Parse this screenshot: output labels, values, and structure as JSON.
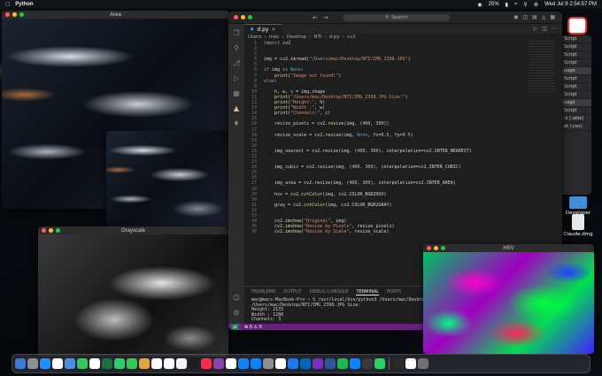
{
  "menubar": {
    "app_name": "Python",
    "clock": "Wed Jul 9  2:54:57 PM",
    "battery": "25%"
  },
  "windows": {
    "area": {
      "title": "Area"
    },
    "grayscale": {
      "title": "Grayscale"
    },
    "hsv": {
      "title": "HSV"
    }
  },
  "vscode": {
    "search_placeholder": "Search",
    "tab_label": "d.py",
    "breadcrumb": [
      "Users",
      "mac",
      "Desktop",
      "NTI",
      "d.py",
      "cv2"
    ],
    "code_lines": [
      [
        "1",
        "import cv2"
      ],
      [
        "2",
        ""
      ],
      [
        "3",
        ""
      ],
      [
        "4",
        "img = cv2.imread(\"/Users/mac/Desktop/NTI/IMG_2398.JPG\")"
      ],
      [
        "5",
        ""
      ],
      [
        "6",
        "if img is None:"
      ],
      [
        "7",
        "    print(\"Image not found!\")"
      ],
      [
        "8",
        "else:"
      ],
      [
        "9",
        ""
      ],
      [
        "10",
        "    h, w, c = img.shape"
      ],
      [
        "11",
        "    print(\"/Users/mac/Desktop/NTI/IMG_2398.JPG Size:\")"
      ],
      [
        "12",
        "    print(\"Height:\", h)"
      ],
      [
        "13",
        "    print(\"Width :\", w)"
      ],
      [
        "14",
        "    print(\"Channels:\", c)"
      ],
      [
        "15",
        ""
      ],
      [
        "16",
        "    resize_pixels = cv2.resize(img, (400, 300))"
      ],
      [
        "17",
        ""
      ],
      [
        "18",
        "    resize_scale = cv2.resize(img, None, fx=0.5, fy=0.5)"
      ],
      [
        "19",
        ""
      ],
      [
        "20",
        ""
      ],
      [
        "21",
        "    img_nearest = cv2.resize(img, (400, 300), interpolation=cv2.INTER_NEAREST)"
      ],
      [
        "22",
        ""
      ],
      [
        "23",
        ""
      ],
      [
        "24",
        "    img_cubic = cv2.resize(img, (400, 300), interpolation=cv2.INTER_CUBIC)"
      ],
      [
        "25",
        ""
      ],
      [
        "26",
        ""
      ],
      [
        "27",
        "    img_area = cv2.resize(img, (400, 300), interpolation=cv2.INTER_AREA)"
      ],
      [
        "28",
        ""
      ],
      [
        "29",
        "    hsv = cv2.cvtColor(img, cv2.COLOR_BGR2HSV)"
      ],
      [
        "30",
        ""
      ],
      [
        "31",
        "    gray = cv2.cvtColor(img, cv2.COLOR_BGR2GRAY)"
      ],
      [
        "32",
        ""
      ],
      [
        "33",
        ""
      ],
      [
        "34",
        "    cv2.imshow(\"Original\", img)"
      ],
      [
        "35",
        "    cv2.imshow(\"Resize by Pixels\", resize_pixels)"
      ],
      [
        "36",
        "    cv2.imshow(\"Resize by Scale\", resize_scale)"
      ]
    ],
    "panel_tabs": [
      "PROBLEMS",
      "OUTPUT",
      "DEBUG CONSOLE",
      "TERMINAL",
      "PORTS"
    ],
    "active_panel_tab": "TERMINAL",
    "terminal_lines": [
      "mac@macs-MacBook-Pro ~ % /usr/local/bin/python3 /Users/mac/Desktop/NTI/d.py",
      "/Users/mac/Desktop/NTI/IMG_2398.JPG Size:",
      "Height: 2133",
      "Width : 1280",
      "Channels: 3"
    ],
    "status_errors": "0",
    "status_warnings": "0"
  },
  "bgapp_rows": [
    "Script",
    "Script",
    "Script",
    "Script",
    "uage",
    "Script",
    "Script",
    "Script",
    "uage",
    "Script",
    ".k (.abie)",
    "at (.cav)"
  ],
  "desktop": {
    "developer_label": "Developer",
    "claude_label": "Claude.dmg"
  }
}
